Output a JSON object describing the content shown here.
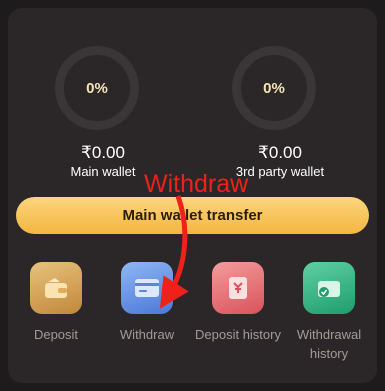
{
  "wallets": [
    {
      "percent": "0%",
      "amount": "₹0.00",
      "label": "Main wallet"
    },
    {
      "percent": "0%",
      "amount": "₹0.00",
      "label": "3rd party wallet"
    }
  ],
  "transfer_button": "Main wallet transfer",
  "actions": [
    {
      "label": "Deposit",
      "icon": "wallet-icon"
    },
    {
      "label": "Withdraw",
      "icon": "card-icon"
    },
    {
      "label": "Deposit history",
      "icon": "receipt-icon"
    },
    {
      "label": "Withdrawal history",
      "icon": "wallet-check-icon"
    }
  ],
  "annotation": {
    "text": "Withdraw",
    "color": "#f0201a"
  }
}
